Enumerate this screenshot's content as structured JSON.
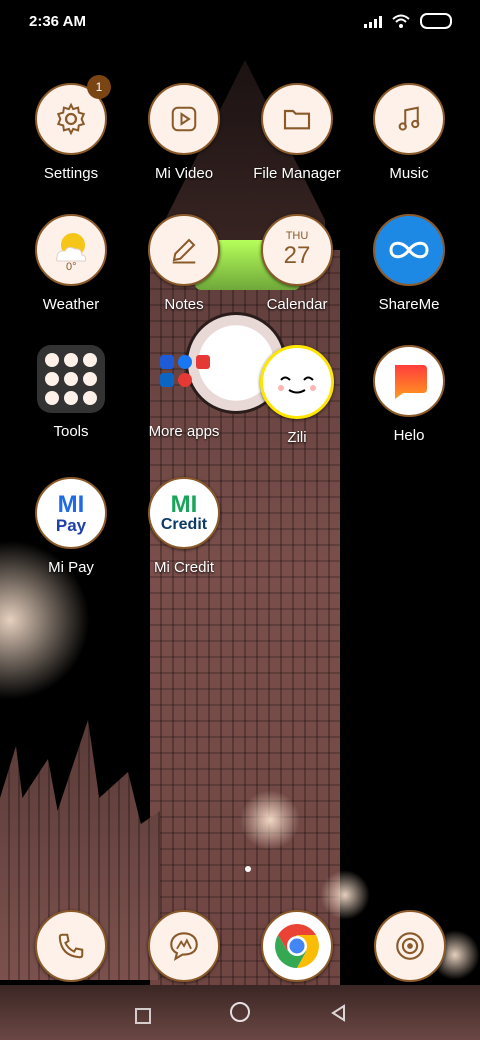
{
  "status": {
    "time": "2:36 AM",
    "icons": [
      "signal-icon",
      "wifi-icon",
      "battery-icon"
    ]
  },
  "apps": [
    {
      "label": "Settings",
      "icon": "gear-icon",
      "badge": "1"
    },
    {
      "label": "Mi Video",
      "icon": "play-icon"
    },
    {
      "label": "File Manager",
      "icon": "folder-icon"
    },
    {
      "label": "Music",
      "icon": "music-note-icon"
    },
    {
      "label": "Weather",
      "icon": "weather-icon",
      "temp": "0°"
    },
    {
      "label": "Notes",
      "icon": "pencil-icon"
    },
    {
      "label": "Calendar",
      "icon": "calendar-icon",
      "day": "THU",
      "date": "27"
    },
    {
      "label": "ShareMe",
      "icon": "infinity-icon"
    },
    {
      "label": "Tools",
      "icon": "folder-tools-icon"
    },
    {
      "label": "More apps",
      "icon": "folder-apps-icon"
    },
    {
      "label": "Zili",
      "icon": "zili-icon"
    },
    {
      "label": "Helo",
      "icon": "chat-bubble-icon"
    },
    {
      "label": "Mi Pay",
      "icon": "mipay-icon",
      "logo_top": "MI",
      "logo_bottom": "Pay"
    },
    {
      "label": "Mi Credit",
      "icon": "micredit-icon",
      "logo_top": "MI",
      "logo_bottom": "Credit"
    }
  ],
  "dock": [
    {
      "icon": "phone-icon"
    },
    {
      "icon": "messages-icon"
    },
    {
      "icon": "chrome-icon"
    },
    {
      "icon": "camera-icon"
    }
  ],
  "colors": {
    "icon_bg": "#fdf1ea",
    "icon_border": "#8a5a2b",
    "badge": "#7a4512",
    "shareme_blue": "#1e88e5"
  }
}
